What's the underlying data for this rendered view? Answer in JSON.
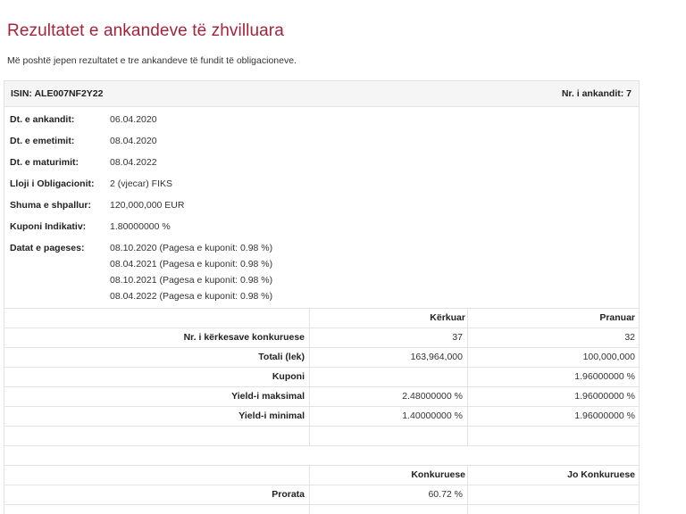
{
  "page": {
    "title": "Rezultatet e ankandeve të zhvilluara",
    "intro": "Më poshtë jepen rezultatet e tre ankandeve të fundit të obligacioneve."
  },
  "auction": {
    "isin": "ISIN: ALE007NF2Y22",
    "auction_no": "Nr. i ankandit: 7",
    "info": [
      {
        "label": "Dt. e ankandit:",
        "value": "06.04.2020"
      },
      {
        "label": "Dt. e emetimit:",
        "value": "08.04.2020"
      },
      {
        "label": "Dt. e maturimit:",
        "value": "08.04.2022"
      },
      {
        "label": "Lloji i Obligacionit:",
        "value": "2 (vjecar) FIKS"
      },
      {
        "label": "Shuma e shpallur:",
        "value": "120,000,000 EUR"
      },
      {
        "label": "Kuponi Indikativ:",
        "value": "1.80000000 %"
      }
    ],
    "payment_label": "Datat e pageses:",
    "payments": [
      "08.10.2020 (Pagesa e kuponit: 0.98 %)",
      "08.04.2021 (Pagesa e kuponit: 0.98 %)",
      "08.10.2021 (Pagesa e kuponit: 0.98 %)",
      "08.04.2022 (Pagesa e kuponit: 0.98 %)"
    ],
    "results_header": {
      "requested": "Kërkuar",
      "accepted": "Pranuar"
    },
    "results": [
      {
        "label": "Nr. i kërkesave konkuruese",
        "requested": "37",
        "accepted": "32"
      },
      {
        "label": "Totali (lek)",
        "requested": "163,964,000",
        "accepted": "100,000,000"
      },
      {
        "label": "Kuponi",
        "requested": "",
        "accepted": "1.96000000 %"
      },
      {
        "label": "Yield-i maksimal",
        "requested": "2.48000000 %",
        "accepted": "1.96000000 %"
      },
      {
        "label": "Yield-i minimal",
        "requested": "1.40000000 %",
        "accepted": "1.96000000 %"
      }
    ],
    "prorata_header": {
      "competitive": "Konkuruese",
      "noncompetitive": "Jo Konkuruese"
    },
    "prorata": {
      "label": "Prorata",
      "competitive": "60.72 %",
      "noncompetitive": ""
    }
  }
}
